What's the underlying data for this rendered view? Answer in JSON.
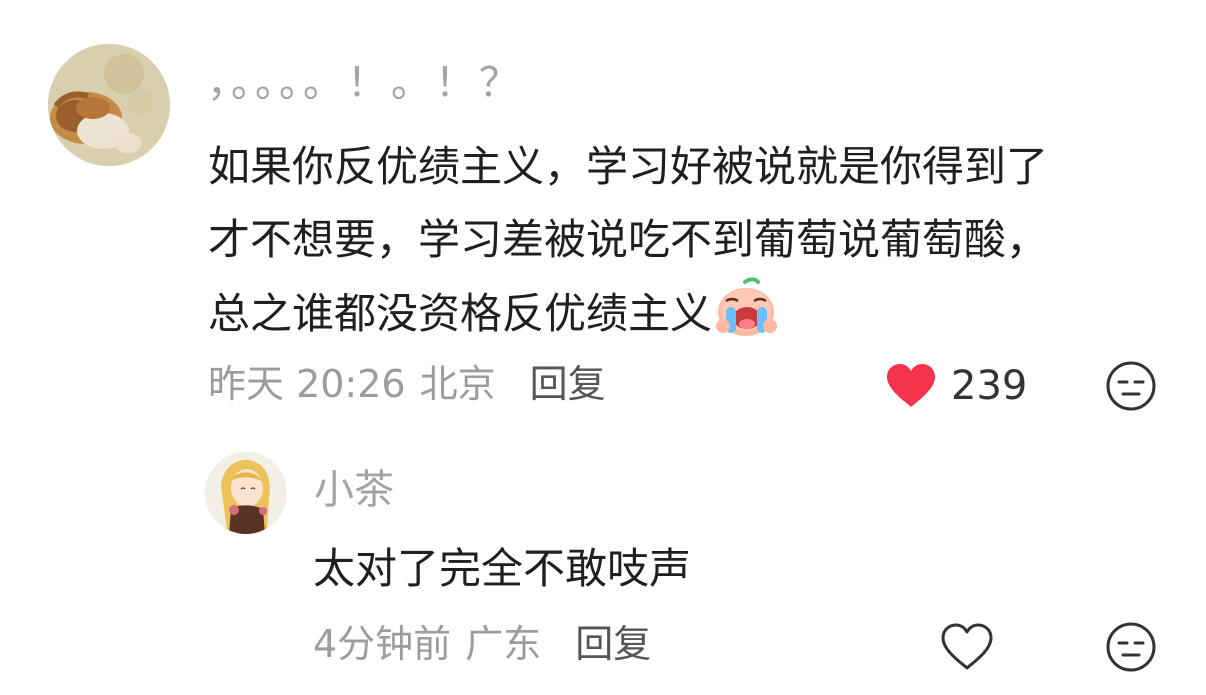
{
  "comment": {
    "username": "，。。。。！。！？",
    "text_lines": [
      "如果你反优绩主义，学习好被说就是你得到了",
      "才不想要，学习差被说吃不到葡萄说葡萄酸，",
      "总之谁都没资格反优绩主义"
    ],
    "emoji": "crying-laughing-sticker",
    "time": "昨天 20:26",
    "location": "北京",
    "reply_label": "回复",
    "like_count": "239",
    "liked": true,
    "colors": {
      "like_active": "#f4344b",
      "meta": "#9c9c9c",
      "username": "#a3a3a3"
    }
  },
  "reply": {
    "username": "小茶",
    "text": "太对了完全不敢吱声",
    "time": "4分钟前",
    "location": "广东",
    "reply_label": "回复",
    "liked": false
  }
}
